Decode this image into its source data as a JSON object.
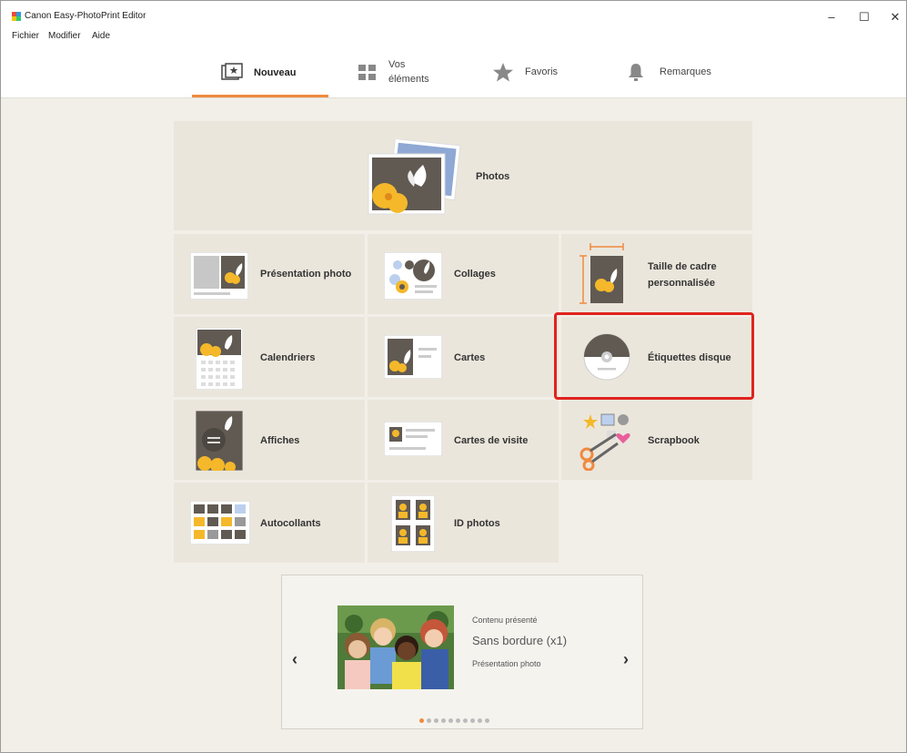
{
  "window": {
    "title": "Canon Easy-PhotoPrint Editor",
    "minimize": "–",
    "maximize": "☐",
    "close": "✕"
  },
  "menu": [
    "Fichier",
    "Modifier",
    "Aide"
  ],
  "tabs": [
    {
      "label_line1": "Nouveau",
      "label_line2": "",
      "icon": "new-project-icon",
      "active": true
    },
    {
      "label_line1": "Vos",
      "label_line2": "éléments",
      "icon": "grid-icon",
      "active": false
    },
    {
      "label_line1": "Favoris",
      "label_line2": "",
      "icon": "star-icon",
      "active": false
    },
    {
      "label_line1": "Remarques",
      "label_line2": "",
      "icon": "bell-icon",
      "active": false
    }
  ],
  "tiles": {
    "photos": "Photos",
    "presentation": "Présentation photo",
    "collages": "Collages",
    "custom_line1": "Taille de cadre",
    "custom_line2": "personnalisée",
    "calendars": "Calendriers",
    "cards": "Cartes",
    "disc": "Étiquettes disque",
    "posters": "Affiches",
    "business": "Cartes de visite",
    "scrapbook": "Scrapbook",
    "stickers": "Autocollants",
    "id": "ID photos"
  },
  "featured": {
    "heading": "Contenu présenté",
    "title": "Sans bordure (x1)",
    "subtitle": "Présentation photo",
    "prev": "‹",
    "next": "›",
    "page_count": 10,
    "active_page": 0
  },
  "colors": {
    "accent": "#f08a3e",
    "highlight": "#e0231f",
    "tile_bg": "#ebe6dc",
    "photo_dark": "#615a53",
    "flower": "#f4b82a"
  }
}
